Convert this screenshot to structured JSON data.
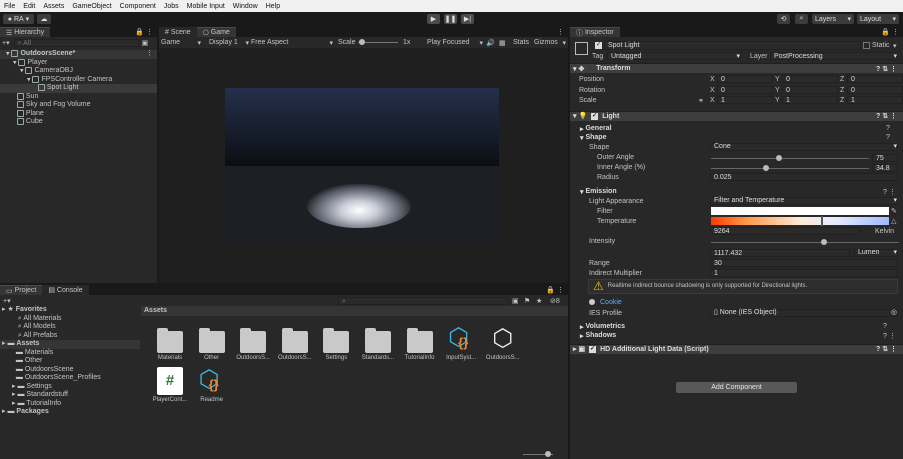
{
  "menubar": {
    "items": [
      "File",
      "Edit",
      "Assets",
      "GameObject",
      "Component",
      "Jobs",
      "Mobile Input",
      "Window",
      "Help"
    ]
  },
  "toolbar": {
    "account": "RA",
    "layers": "Layers",
    "layout": "Layout"
  },
  "hierarchy": {
    "tab": "Hierarchy",
    "search_placeholder": "All",
    "items": [
      {
        "label": "OutdoorsScene*",
        "depth": 0
      },
      {
        "label": "Player",
        "depth": 1
      },
      {
        "label": "CameraOBJ",
        "depth": 2
      },
      {
        "label": "FPSController Camera",
        "depth": 3
      },
      {
        "label": "Spot Light",
        "depth": 4
      },
      {
        "label": "Sun",
        "depth": 1
      },
      {
        "label": "Sky and Fog Volume",
        "depth": 1
      },
      {
        "label": "Plane",
        "depth": 1
      },
      {
        "label": "Cube",
        "depth": 1
      }
    ]
  },
  "view": {
    "tabs": [
      "Scene",
      "Game"
    ],
    "game_bar": {
      "mode": "Game",
      "display": "Display 1",
      "aspect": "Free Aspect",
      "scale_label": "Scale",
      "scale_value": "1x",
      "play_focused": "Play Focused",
      "stats": "Stats",
      "gizmos": "Gizmos"
    }
  },
  "project": {
    "tabs": [
      "Project",
      "Console"
    ],
    "hidden_count": "8",
    "favorites": {
      "label": "Favorites",
      "items": [
        "All Materials",
        "All Models",
        "All Prefabs"
      ]
    },
    "assets_tree": {
      "label": "Assets",
      "items": [
        "Materials",
        "Other",
        "OutdoorsScene",
        "OutdoorsScene_Profiles",
        "Settings",
        "Standardstuff",
        "TutorialInfo"
      ]
    },
    "packages": "Packages",
    "breadcrumb": "Assets",
    "grid": [
      {
        "name": "Materials",
        "kind": "folder"
      },
      {
        "name": "Other",
        "kind": "folder"
      },
      {
        "name": "OutdoorsS...",
        "kind": "folder"
      },
      {
        "name": "OutdoorsS...",
        "kind": "folder"
      },
      {
        "name": "Settings",
        "kind": "folder"
      },
      {
        "name": "Standards...",
        "kind": "folder"
      },
      {
        "name": "TutorialInfo",
        "kind": "folder"
      },
      {
        "name": "InputSyst...",
        "kind": "inputsys"
      },
      {
        "name": "OutdoorsS...",
        "kind": "unity"
      },
      {
        "name": "PlayerCont...",
        "kind": "script"
      },
      {
        "name": "Readme",
        "kind": "inputsys"
      }
    ]
  },
  "inspector": {
    "tab": "Inspector",
    "object_name": "Spot Light",
    "static_label": "Static",
    "tag_label": "Tag",
    "tag_value": "Untagged",
    "layer_label": "Layer",
    "layer_value": "PostProcessing",
    "transform": {
      "title": "Transform",
      "rows": [
        {
          "label": "Position",
          "x": "0",
          "y": "0",
          "z": "0"
        },
        {
          "label": "Rotation",
          "x": "0",
          "y": "0",
          "z": "0"
        },
        {
          "label": "Scale",
          "x": "1",
          "y": "1",
          "z": "1"
        }
      ],
      "axis": [
        "X",
        "Y",
        "Z"
      ]
    },
    "light": {
      "title": "Light",
      "general": "General",
      "shape_section": "Shape",
      "shape_label": "Shape",
      "shape_value": "Cone",
      "outer_label": "Outer Angle",
      "outer_value": "75",
      "outer_level": 0.43,
      "inner_label": "Inner Angle (%)",
      "inner_value": "34.8",
      "inner_level": 0.35,
      "radius_label": "Radius",
      "radius_value": "0.025",
      "emission": "Emission",
      "appearance_label": "Light Appearance",
      "appearance_value": "Filter and Temperature",
      "filter_label": "Filter",
      "temperature_label": "Temperature",
      "temperature_value": "9264",
      "temperature_unit": "Kelvin",
      "temperature_level": 0.62,
      "intensity_label": "Intensity",
      "intensity_value": "1117.432",
      "intensity_unit": "Lumen",
      "intensity_level": 0.6,
      "range_label": "Range",
      "range_value": "30",
      "indirect_label": "Indirect Multiplier",
      "indirect_value": "1",
      "warning": "Realtime indirect bounce shadowing is only supported for Directional lights.",
      "cookie_label": "Cookie",
      "ies_label": "IES Profile",
      "ies_value": "None (IES Object)",
      "volumetrics": "Volumetrics",
      "shadows": "Shadows"
    },
    "hd_component": "HD Additional Light Data (Script)",
    "add_component": "Add Component"
  },
  "colors": {
    "accent": "#3a72b0",
    "warning": "#e2c21b",
    "script_green": "#2e7d32",
    "inputsys_cyan": "#37b6e6",
    "inputsys_orange": "#f08a2c"
  }
}
